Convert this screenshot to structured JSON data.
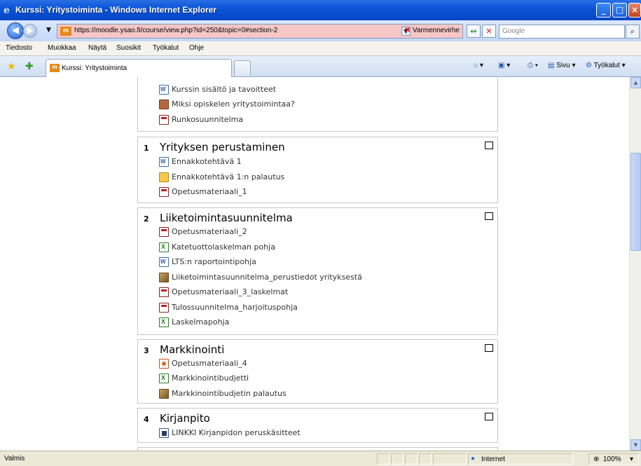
{
  "window": {
    "title": "Kurssi: Yritystoiminta - Windows Internet Explorer"
  },
  "address_bar": {
    "url": "https://moodle.ysao.fi/course/view.php?id=250&topic=0#section-2",
    "cert_error": "Varmennevirhe",
    "search_placeholder": "Google"
  },
  "menu": {
    "items": [
      "Tiedosto",
      "Muokkaa",
      "Näytä",
      "Suosikit",
      "Työkalut",
      "Ohje"
    ]
  },
  "tabs": {
    "active_label": "Kurssi: Yritystoiminta",
    "page_label": "Sivu",
    "tools_label": "Työkalut"
  },
  "course": {
    "top_items": [
      {
        "icon": "word-doc-icon",
        "label": "Kurssin sisältö ja tavoitteet"
      },
      {
        "icon": "questionnaire-icon",
        "label": "Miksi opiskelen yritystoimintaa?"
      },
      {
        "icon": "pdf-icon",
        "label": "Runkosuunnitelma"
      }
    ],
    "sections": [
      {
        "number": "1",
        "title": "Yrityksen perustaminen",
        "items": [
          {
            "icon": "word-doc-icon",
            "label": "Ennakkotehtävä 1"
          },
          {
            "icon": "assignment-folder-icon",
            "label": "Ennakkotehtävä 1:n palautus"
          },
          {
            "icon": "pdf-icon",
            "label": "Opetusmateriaali_1"
          }
        ]
      },
      {
        "number": "2",
        "title": "Liiketoimintasuunnitelma",
        "items": [
          {
            "icon": "pdf-icon",
            "label": "Opetusmateriaali_2"
          },
          {
            "icon": "excel-icon",
            "label": "Katetuottolaskelman pohja"
          },
          {
            "icon": "word-doc-icon",
            "label": "LTS:n raportointipohja"
          },
          {
            "icon": "assignment-icon",
            "label": "Liiketoimintasuunnitelma_perustiedot yrityksestä"
          },
          {
            "icon": "pdf-icon",
            "label": "Opetusmateriaali_3_laskelmat"
          },
          {
            "icon": "pdf-icon",
            "label": "Tulossuunnitelma_harjoituspohja"
          },
          {
            "icon": "excel-icon",
            "label": "Laskelmapohja"
          }
        ]
      },
      {
        "number": "3",
        "title": "Markkinointi",
        "items": [
          {
            "icon": "powerpoint-icon",
            "label": "Opetusmateriaali_4"
          },
          {
            "icon": "excel-icon",
            "label": "Markkinointibudjetti"
          },
          {
            "icon": "assignment-icon",
            "label": "Markkinointibudjetin palautus"
          }
        ]
      },
      {
        "number": "4",
        "title": "Kirjanpito",
        "items": [
          {
            "icon": "link-icon",
            "label": "LINKKI Kirjanpidon peruskäsitteet"
          }
        ]
      }
    ]
  },
  "status": {
    "left": "Valmis",
    "zone": "Internet",
    "zoom": "100%"
  }
}
